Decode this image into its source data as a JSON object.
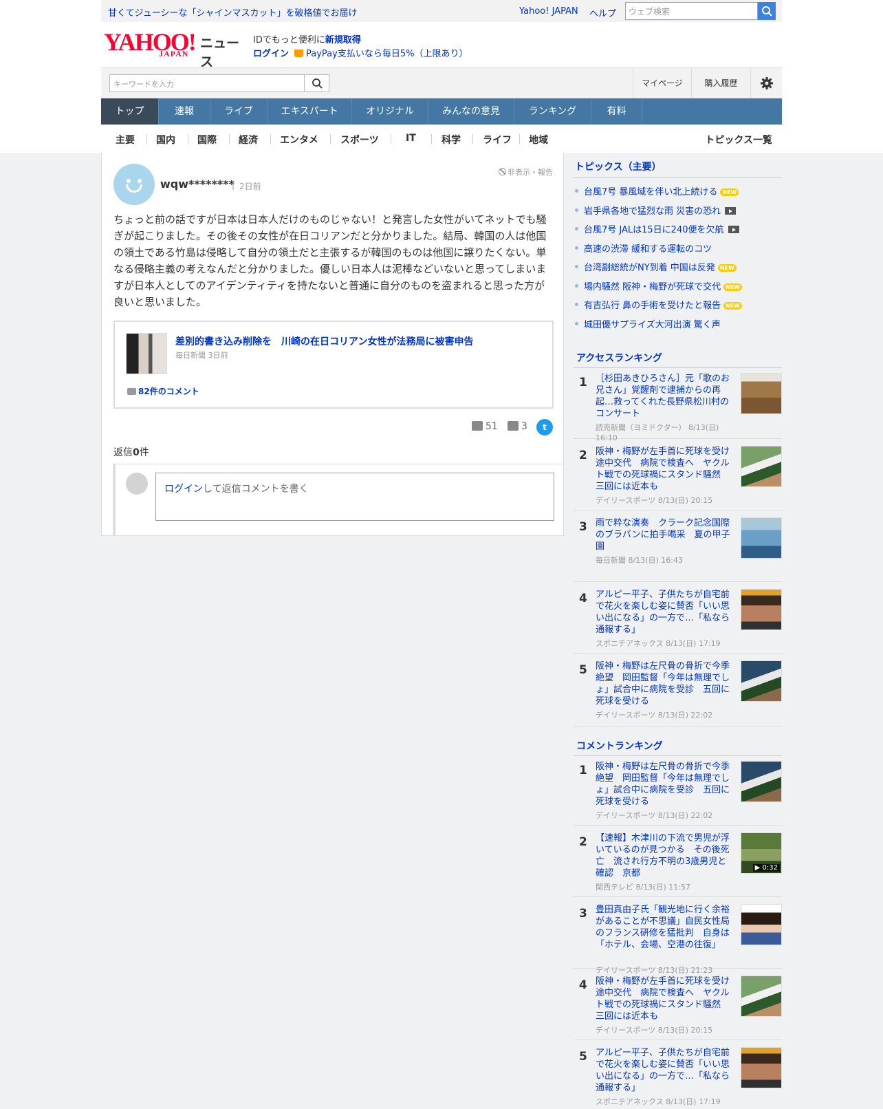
{
  "header": {
    "promo": "甘くてジューシーな「シャインマスカット」を破格値でお届け",
    "links": {
      "yahoo_japan": "Yahoo! JAPAN",
      "help": "ヘルプ"
    },
    "web_search_placeholder": "ウェブ検索",
    "logo": {
      "yahoo": "YAHOO!",
      "japan": "JAPAN",
      "news": "ニュース"
    },
    "id_promo": "IDでもっと便利に",
    "id_promo_link": "新規取得",
    "login": "ログイン",
    "paypay": "PayPay支払いなら毎日5%（上限あり）"
  },
  "search": {
    "placeholder": "キーワードを入力",
    "mypage": "マイページ",
    "history": "購入履歴"
  },
  "main_tabs": [
    "トップ",
    "速報",
    "ライブ",
    "エキスパート",
    "オリジナル",
    "みんなの意見",
    "ランキング",
    "有料"
  ],
  "sub_tabs": [
    "主要",
    "国内",
    "国際",
    "経済",
    "エンタメ",
    "スポーツ",
    "IT",
    "科学",
    "ライフ",
    "地域"
  ],
  "topics_all": "トピックス一覧",
  "comment": {
    "username": "wqw********",
    "time_sep": "|",
    "time_ago": "2日前",
    "hide_report": "非表示・報告",
    "text": "ちょっと前の話ですが日本は日本人だけのものじゃない！と発言した女性がいてネットでも騒ぎが起こりました。その後その女性が在日コリアンだと分かりました。結局、韓国の人は他国の領土である竹島は侵略して自分の領土だと主張するが韓国のものは他国に譲りたくない。単なる侵略主義の考えなんだと分かりました。優しい日本人は泥棒などいないと思ってしまいますが日本人としてのアイデンティティを持たないと普通に自分のものを盗まれると思った方が良いと思いました。",
    "article": {
      "title": "差別的書き込み削除を　川崎の在日コリアン女性が法務局に被害申告",
      "source": "毎日新聞 3日前",
      "comments": "82件のコメント"
    },
    "likes": "51",
    "dislikes": "3",
    "reply_label": "返信",
    "reply_num": "0",
    "reply_suffix": "件",
    "reply_login": "ログイン",
    "reply_prompt": "して返信コメントを書く"
  },
  "sidebar": {
    "topics_title": "トピックス（主要）",
    "topics": [
      {
        "text": "台風7号 暴風域を伴い北上続ける",
        "badge": "NEW"
      },
      {
        "text": "岩手県各地で猛烈な雨 災害の恐れ",
        "badge": "video"
      },
      {
        "text": "台風7号 JALは15日に240便を欠航",
        "badge": "video"
      },
      {
        "text": "高速の渋滞 緩和する運転のコツ",
        "badge": ""
      },
      {
        "text": "台湾副総統がNY到着 中国は反発",
        "badge": "NEW"
      },
      {
        "text": "場内騒然 阪神・梅野が死球で交代",
        "badge": "NEW"
      },
      {
        "text": "有吉弘行 鼻の手術を受けたと報告",
        "badge": "NEW"
      },
      {
        "text": "城田優サプライズ大河出演 驚く声",
        "badge": ""
      }
    ],
    "access_title": "アクセスランキング",
    "access": [
      {
        "num": "1",
        "title": "［杉田あきひろさん］元「歌のお兄さん」覚醒剤で逮捕からの再起…救ってくれた長野県松川村のコンサート",
        "source": "読売新聞（ヨミドクター） 8/13(日) 16:10",
        "img": "img-orange"
      },
      {
        "num": "2",
        "title": "阪神・梅野が左手首に死球を受け途中交代　病院で検査へ　ヤクルト戦での死球禍にスタンド騒然　三回には近本も",
        "source": "デイリースポーツ 8/13(日) 20:15",
        "img": "img-field"
      },
      {
        "num": "3",
        "title": "雨で粋な演奏　クラーク記念国際のブラバンに拍手喝采　夏の甲子園",
        "source": "毎日新聞 8/13(日) 16:43",
        "img": "img-band"
      },
      {
        "num": "4",
        "title": "アルピー平子、子供たちが自宅前で花火を楽しむ姿に賛否「いい思い出になる」の一方で…「私なら通報する」",
        "source": "スポニチアネックス 8/13(日) 17:19",
        "img": "img-man"
      },
      {
        "num": "5",
        "title": "阪神・梅野は左尺骨の骨折で今季絶望　岡田監督「今年は無理でしょ」試合中に病院を受診　五回に死球を受ける",
        "source": "デイリースポーツ 8/13(日) 22:02",
        "img": "img-dark"
      }
    ],
    "comment_title": "コメントランキング",
    "comment_rank": [
      {
        "num": "1",
        "title": "阪神・梅野は左尺骨の骨折で今季絶望　岡田監督「今年は無理でしょ」試合中に病院を受診　五回に死球を受ける",
        "source": "デイリースポーツ 8/13(日) 22:02",
        "img": "img-dark"
      },
      {
        "num": "2",
        "title": "【速報】木津川の下流で男児が浮いているのが見つかる　その後死亡　流され行方不明の3歳男児と確認　京都",
        "source": "関西テレビ 8/13(日) 11:57",
        "img": "img-river",
        "duration": "▶ 0:32"
      },
      {
        "num": "3",
        "title": "豊田真由子氏「観光地に行く余裕があることが不思議」自民女性局のフランス研修を猛批判　自身は「ホテル、会場、空港の往復」",
        "source": "デイリースポーツ 8/13(日) 21:23",
        "img": "img-woman"
      },
      {
        "num": "4",
        "title": "阪神・梅野が左手首に死球を受け途中交代　病院で検査へ　ヤクルト戦での死球禍にスタンド騒然　三回には近本も",
        "source": "デイリースポーツ 8/13(日) 20:15",
        "img": "img-field"
      },
      {
        "num": "5",
        "title": "アルピー平子、子供たちが自宅前で花火を楽しむ姿に賛否「いい思い出になる」の一方で…「私なら通報する」",
        "source": "スポニチアネックス 8/13(日) 17:19",
        "img": "img-man"
      }
    ]
  },
  "colors": {
    "link": "#0033cc",
    "nav": "#4477a3",
    "nav_active": "#3b4a5a",
    "logo": "#ff0033",
    "new_badge": "#ffcc00"
  }
}
